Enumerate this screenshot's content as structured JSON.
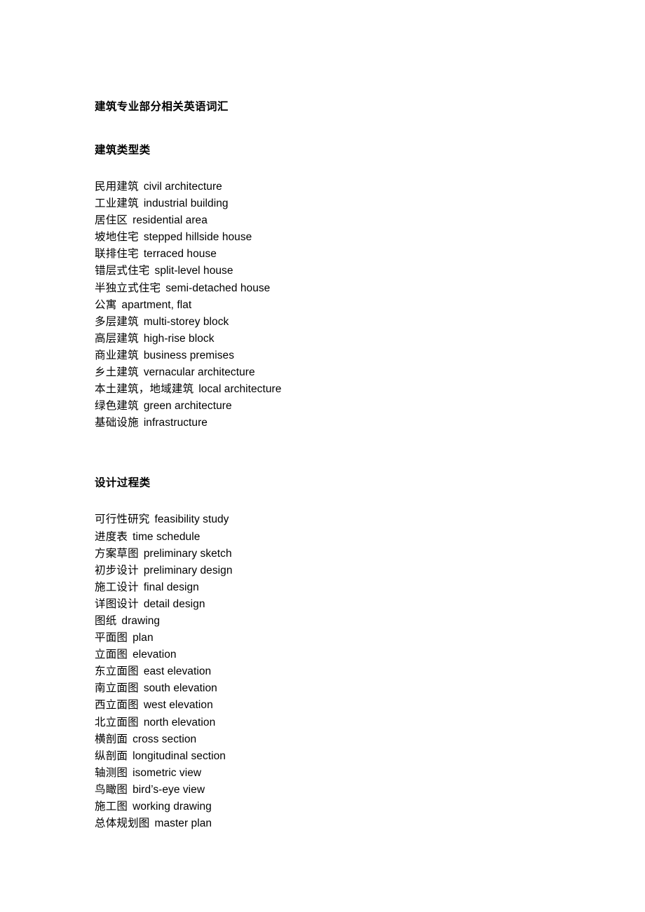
{
  "document": {
    "title": "建筑专业部分相关英语词汇",
    "background_color": "#ffffff",
    "text_color": "#000000"
  },
  "sections": [
    {
      "heading": "建筑类型类",
      "entries": [
        {
          "cn": "民用建筑",
          "en": "civil architecture"
        },
        {
          "cn": "工业建筑",
          "en": "industrial building"
        },
        {
          "cn": "居住区",
          "en": "residential area"
        },
        {
          "cn": "坡地住宅",
          "en": "stepped hillside house"
        },
        {
          "cn": "联排住宅",
          "en": "terraced house"
        },
        {
          "cn": "错层式住宅",
          "en": "split-level house"
        },
        {
          "cn": "半独立式住宅",
          "en": "semi-detached house"
        },
        {
          "cn": "公寓",
          "en": "apartment, flat"
        },
        {
          "cn": "多层建筑",
          "en": "multi-storey block"
        },
        {
          "cn": "高层建筑",
          "en": "high-rise block"
        },
        {
          "cn": "商业建筑",
          "en": "business premises"
        },
        {
          "cn": "乡土建筑",
          "en": "vernacular architecture"
        },
        {
          "cn": "本土建筑，地域建筑",
          "en": "local architecture"
        },
        {
          "cn": "绿色建筑",
          "en": "green architecture"
        },
        {
          "cn": "基础设施",
          "en": "infrastructure"
        }
      ]
    },
    {
      "heading": "设计过程类",
      "entries": [
        {
          "cn": "可行性研究",
          "en": "feasibility study"
        },
        {
          "cn": "进度表",
          "en": "time schedule"
        },
        {
          "cn": "方案草图",
          "en": "preliminary sketch"
        },
        {
          "cn": "初步设计",
          "en": "preliminary design"
        },
        {
          "cn": "施工设计",
          "en": "final design"
        },
        {
          "cn": "详图设计",
          "en": "detail design"
        },
        {
          "cn": "图纸",
          "en": "drawing"
        },
        {
          "cn": "平面图",
          "en": "plan"
        },
        {
          "cn": "立面图",
          "en": "elevation"
        },
        {
          "cn": "东立面图",
          "en": "east elevation"
        },
        {
          "cn": "南立面图",
          "en": "south elevation"
        },
        {
          "cn": "西立面图",
          "en": "west elevation"
        },
        {
          "cn": "北立面图",
          "en": "north elevation"
        },
        {
          "cn": "横剖面",
          "en": "cross section"
        },
        {
          "cn": "纵剖面",
          "en": "longitudinal section"
        },
        {
          "cn": "轴测图",
          "en": "isometric view"
        },
        {
          "cn": "鸟瞰图",
          "en": "bird’s-eye view"
        },
        {
          "cn": "施工图",
          "en": "working drawing"
        },
        {
          "cn": "总体规划图",
          "en": "master plan"
        }
      ]
    }
  ]
}
